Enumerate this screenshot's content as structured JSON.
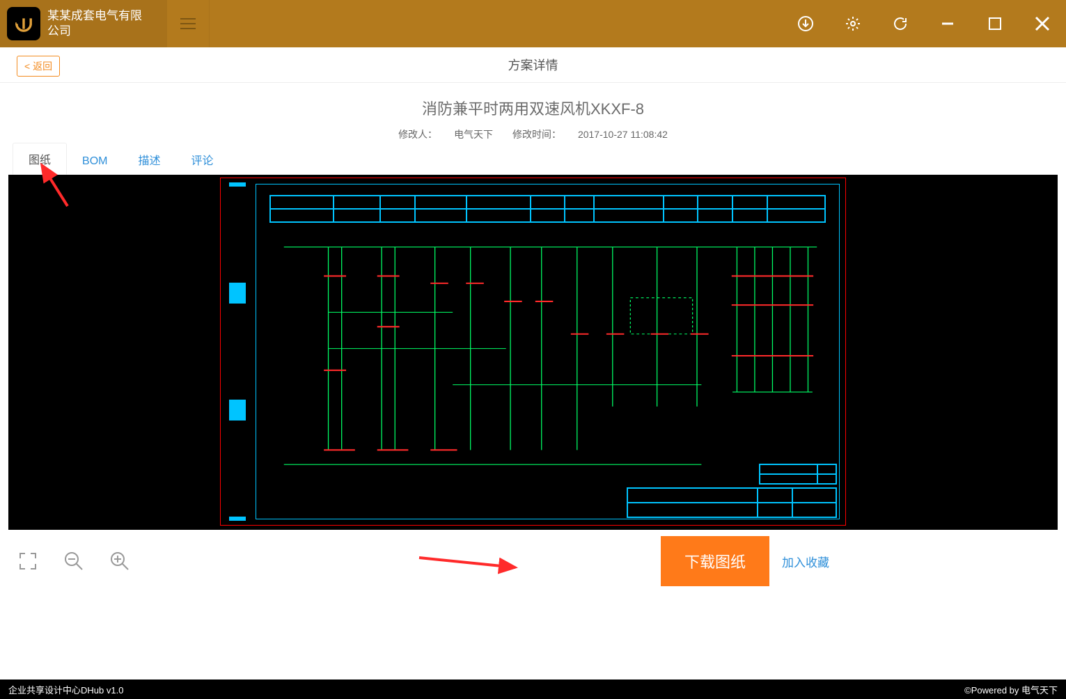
{
  "titlebar": {
    "company_name": "某某成套电气有限公司"
  },
  "page": {
    "back_label": "< 返回",
    "header_title": "方案详情",
    "doc_title": "消防兼平时两用双速风机XKXF-8",
    "modifier_label": "修改人：",
    "modifier_value": "电气天下",
    "time_label": "修改时间：",
    "time_value": "2017-10-27 11:08:42"
  },
  "tabs": [
    {
      "id": "drawing",
      "label": "图纸",
      "active": true
    },
    {
      "id": "bom",
      "label": "BOM",
      "active": false
    },
    {
      "id": "desc",
      "label": "描述",
      "active": false
    },
    {
      "id": "comment",
      "label": "评论",
      "active": false
    }
  ],
  "toolbar": {
    "download_label": "下载图纸",
    "favorite_label": "加入收藏"
  },
  "footer": {
    "left": "企业共享设计中心DHub v1.0",
    "right": "©Powered by 电气天下"
  }
}
